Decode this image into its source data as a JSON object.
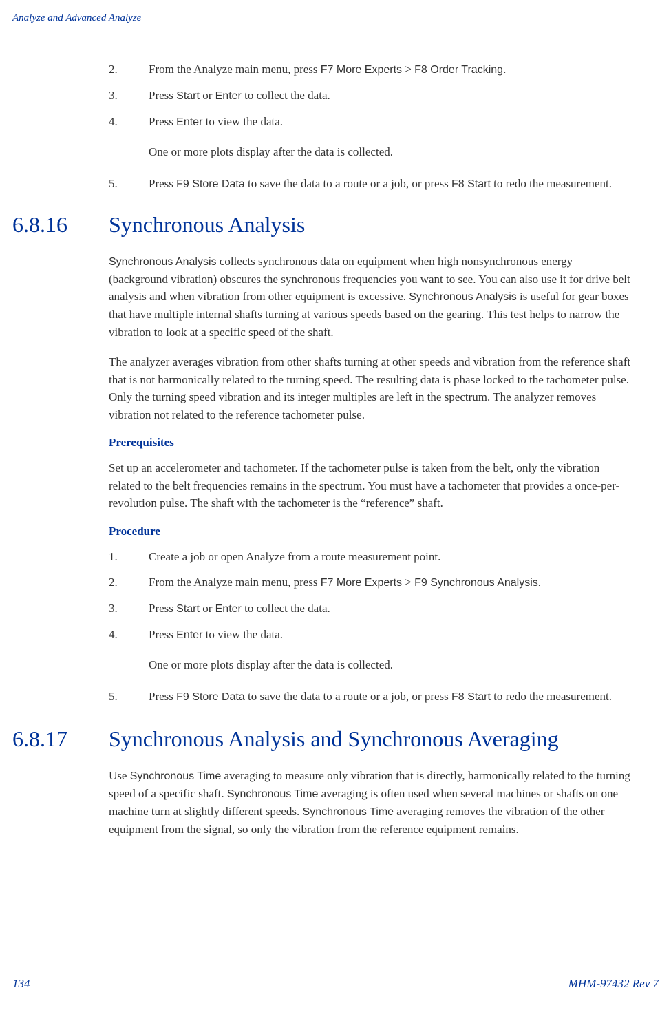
{
  "header": "Analyze and Advanced Analyze",
  "top_steps": {
    "s2_num": "2.",
    "s2_a": "From the Analyze main menu, press ",
    "s2_b": "F7 More Experts",
    "s2_c": " > ",
    "s2_d": "F8 Order Tracking",
    "s2_e": ".",
    "s3_num": "3.",
    "s3_a": "Press ",
    "s3_b": "Start",
    "s3_c": " or ",
    "s3_d": "Enter",
    "s3_e": " to collect the data.",
    "s4_num": "4.",
    "s4_a": "Press ",
    "s4_b": "Enter",
    "s4_c": " to view the data.",
    "s4_sub": "One or more plots display after the data is collected.",
    "s5_num": "5.",
    "s5_a": "Press ",
    "s5_b": "F9 Store Data",
    "s5_c": " to save the data to a route or a job, or press ",
    "s5_d": "F8 Start",
    "s5_e": " to redo the measurement."
  },
  "sec16": {
    "num": "6.8.16",
    "title": "Synchronous Analysis",
    "p1_a": "Synchronous Analysis",
    "p1_b": " collects synchronous data on equipment when high nonsynchronous energy (background vibration) obscures the synchronous frequencies you want to see. You can also use it for drive belt analysis and when vibration from other equipment is excessive. ",
    "p1_c": "Synchronous Analysis",
    "p1_d": " is useful for gear boxes that have multiple internal shafts turning at various speeds based on the gearing. This test helps to narrow the vibration to look at a specific speed of the shaft.",
    "p2": "The analyzer averages vibration from other shafts turning at other speeds and vibration from the reference shaft that is not harmonically related to the turning speed. The resulting data is phase locked to the tachometer pulse. Only the turning speed vibration and its integer multiples are left in the spectrum. The analyzer removes vibration not related to the reference tachometer pulse.",
    "prereq_h": "Prerequisites",
    "prereq_p": "Set up an accelerometer and tachometer. If the tachometer pulse is taken from the belt, only the vibration related to the belt frequencies remains in the spectrum. You must have a tachometer that provides a once-per-revolution pulse. The shaft with the tachometer is the “reference” shaft.",
    "proc_h": "Procedure",
    "s1_num": "1.",
    "s1": "Create a job or open Analyze from a route measurement point.",
    "s2_num": "2.",
    "s2_a": "From the Analyze main menu, press ",
    "s2_b": "F7 More Experts",
    "s2_c": " > ",
    "s2_d": "F9 Synchronous Analysis",
    "s2_e": ".",
    "s3_num": "3.",
    "s3_a": "Press ",
    "s3_b": "Start",
    "s3_c": " or ",
    "s3_d": "Enter",
    "s3_e": " to collect the data.",
    "s4_num": "4.",
    "s4_a": "Press ",
    "s4_b": "Enter",
    "s4_c": " to view the data.",
    "s4_sub": "One or more plots display after the data is collected.",
    "s5_num": "5.",
    "s5_a": "Press ",
    "s5_b": "F9 Store Data",
    "s5_c": " to save the data to a route or a job, or press ",
    "s5_d": "F8 Start",
    "s5_e": " to redo the measurement."
  },
  "sec17": {
    "num": "6.8.17",
    "title": "Synchronous Analysis and Synchronous Averaging",
    "p1_a": "Use ",
    "p1_b": "Synchronous Time",
    "p1_c": " averaging to measure only vibration that is directly, harmonically related to the turning speed of a specific shaft. ",
    "p1_d": "Synchronous Time",
    "p1_e": " averaging is often used when several machines or shafts on one machine turn at slightly different speeds. ",
    "p1_f": "Synchronous Time",
    "p1_g": " averaging removes the vibration of the other equipment from the signal, so only the vibration from the reference equipment remains."
  },
  "footer": {
    "page": "134",
    "doc": "MHM-97432 Rev 7"
  }
}
